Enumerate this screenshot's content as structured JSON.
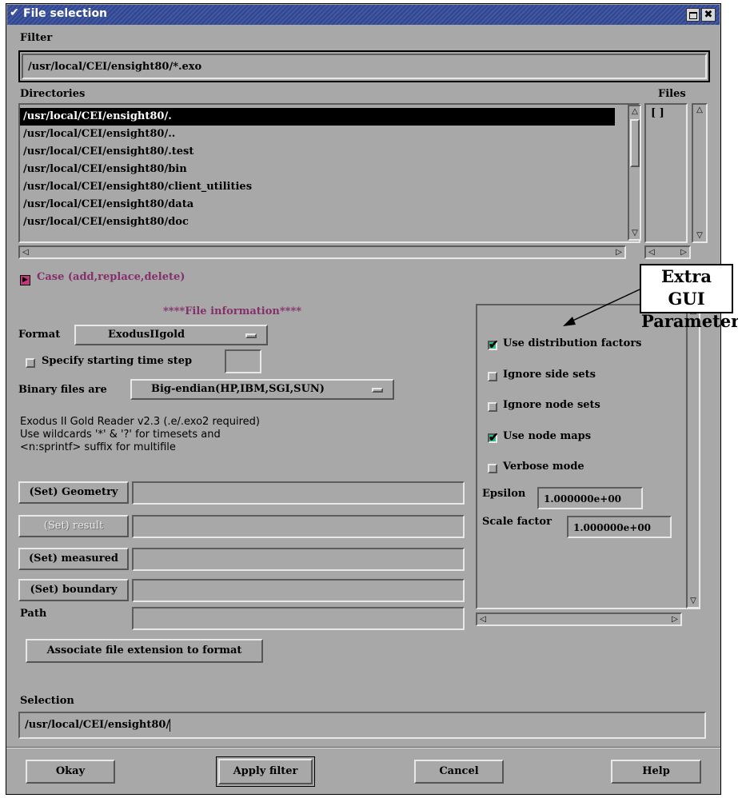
{
  "window": {
    "title": "File selection"
  },
  "filter": {
    "label": "Filter",
    "value": "/usr/local/CEI/ensight80/*.exo"
  },
  "directories": {
    "label": "Directories",
    "items": [
      "/usr/local/CEI/ensight80/.",
      "/usr/local/CEI/ensight80/..",
      "/usr/local/CEI/ensight80/.test",
      "/usr/local/CEI/ensight80/bin",
      "/usr/local/CEI/ensight80/client_utilities",
      "/usr/local/CEI/ensight80/data",
      "/usr/local/CEI/ensight80/doc"
    ]
  },
  "files": {
    "label": "Files",
    "items": [
      "[  ]"
    ]
  },
  "case": {
    "label": "Case (add,replace,delete)"
  },
  "file_info": {
    "heading": "****File information****"
  },
  "format": {
    "label": "Format",
    "value": "ExodusIIgold"
  },
  "start_step": {
    "label": "Specify starting time step",
    "value": ""
  },
  "binary": {
    "label": "Binary files are",
    "value": "Big-endian(HP,IBM,SGI,SUN)"
  },
  "reader_info": {
    "line1": "Exodus II Gold Reader v2.3 (.e/.exo2 required)",
    "line2": "Use wildcards '*' & '?' for timesets and",
    "line3": "<n:sprintf> suffix for multifile"
  },
  "set_buttons": {
    "geometry": "(Set) Geometry",
    "result": "(Set) result",
    "measured": "(Set) measured",
    "boundary": "(Set) boundary",
    "path": "Path"
  },
  "associate": {
    "label": "Associate file extension to format"
  },
  "annotation": {
    "line1": "Extra GUI",
    "line2": "Parameters"
  },
  "extra": {
    "use_dist": "Use distribution factors",
    "ignore_side": "Ignore side sets",
    "ignore_node": "Ignore node sets",
    "use_node_maps": "Use node maps",
    "verbose": "Verbose mode",
    "epsilon_label": "Epsilon",
    "epsilon_value": "1.000000e+00",
    "scale_label": "Scale factor",
    "scale_value": "1.000000e+00"
  },
  "checks": {
    "use_dist": true,
    "ignore_side": false,
    "ignore_node": false,
    "use_node_maps": true,
    "verbose": false,
    "start_step": false
  },
  "selection": {
    "label": "Selection",
    "value": "/usr/local/CEI/ensight80/"
  },
  "buttons": {
    "okay": "Okay",
    "apply": "Apply filter",
    "cancel": "Cancel",
    "help": "Help"
  },
  "colors": {
    "window_bg": "#a8a8a8",
    "titlebar": "#2f4690",
    "check_on": "#2fbf8a",
    "accent_purple": "#85306c"
  }
}
